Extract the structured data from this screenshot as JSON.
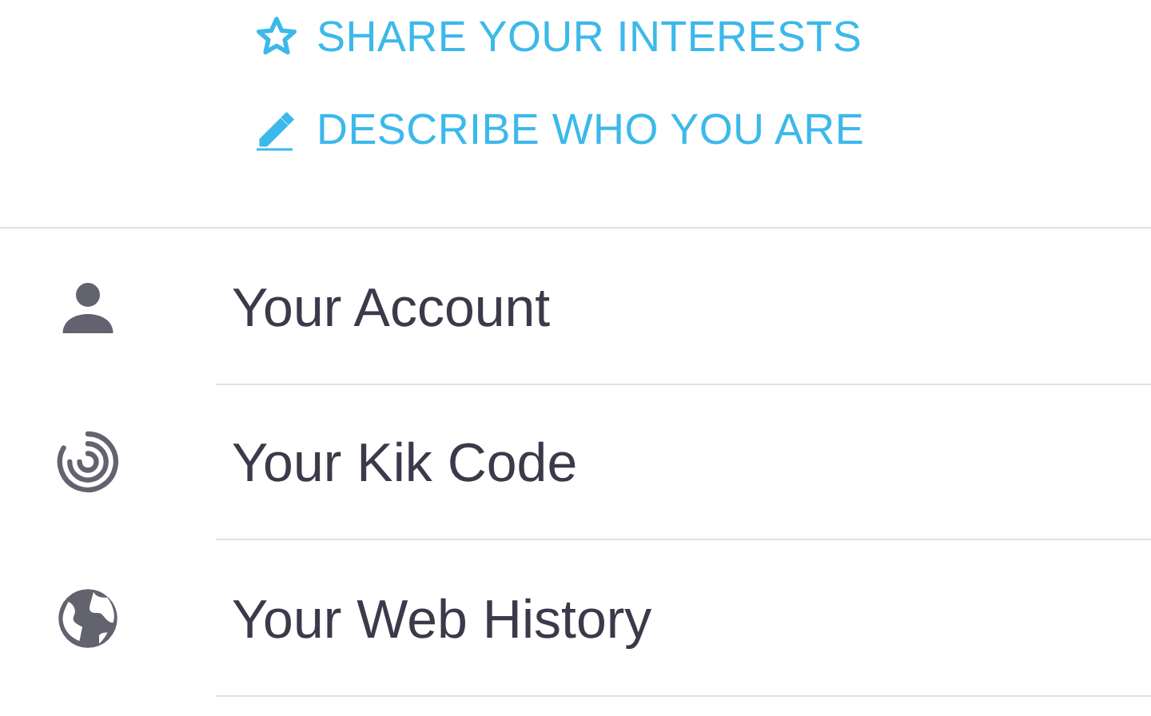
{
  "profile_links": [
    {
      "kind": "star",
      "label": "SHARE YOUR INTERESTS"
    },
    {
      "kind": "pencil",
      "label": "DESCRIBE WHO YOU ARE"
    }
  ],
  "menu_items": [
    {
      "kind": "account",
      "label": "Your Account"
    },
    {
      "kind": "code",
      "label": "Your Kik Code"
    },
    {
      "kind": "web",
      "label": "Your Web History"
    }
  ]
}
